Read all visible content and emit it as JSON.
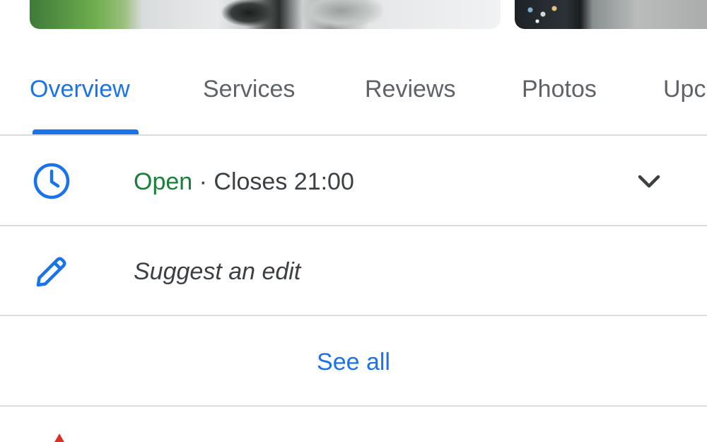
{
  "tabs": [
    {
      "label": "Overview",
      "active": true
    },
    {
      "label": "Services",
      "active": false
    },
    {
      "label": "Reviews",
      "active": false
    },
    {
      "label": "Photos",
      "active": false
    },
    {
      "label": "Upc",
      "active": false
    }
  ],
  "hours": {
    "status": "Open",
    "separator": " · ",
    "closes": "Closes 21:00",
    "icon": "clock-icon",
    "expand_icon": "chevron-down-icon"
  },
  "edit": {
    "label": "Suggest an edit",
    "icon": "pencil-icon"
  },
  "see_all": {
    "label": "See all"
  },
  "bottom_notice": {
    "icon": "warning-icon",
    "text": ""
  },
  "colors": {
    "accent": "#1a73e8",
    "open_green": "#188038",
    "warning_red": "#d93025",
    "text_primary": "#3c4043",
    "text_secondary": "#5f6368",
    "divider": "#dadce0"
  }
}
